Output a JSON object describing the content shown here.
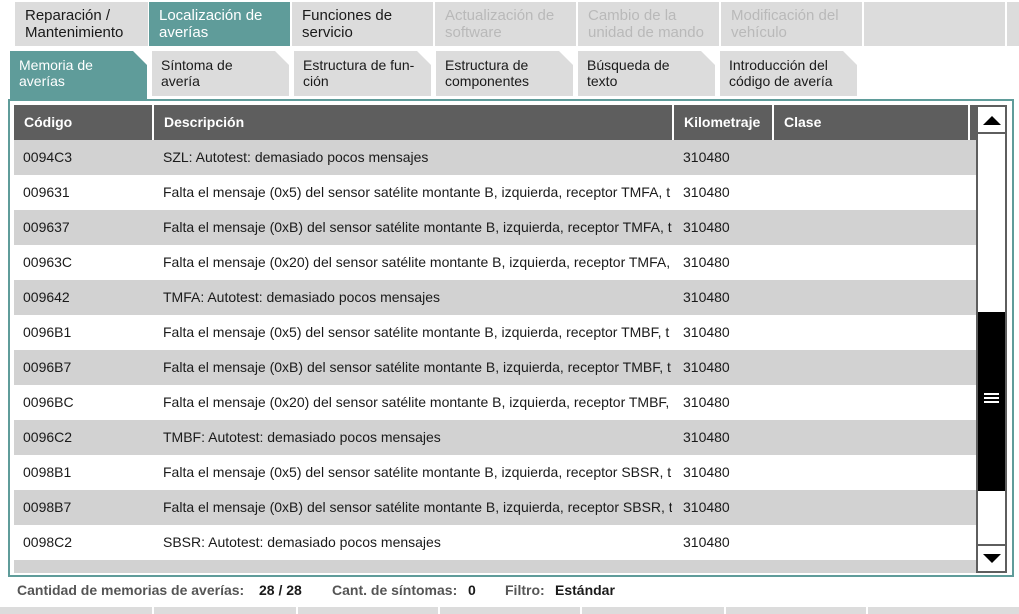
{
  "top_tabs": [
    {
      "label_1": "Reparación /",
      "label_2": "Mantenimiento",
      "state": "normal"
    },
    {
      "label_1": "Localización de",
      "label_2": "averías",
      "state": "active"
    },
    {
      "label_1": "Funciones de",
      "label_2": "servicio",
      "state": "normal"
    },
    {
      "label_1": "Actualización de",
      "label_2": "software",
      "state": "disabled"
    },
    {
      "label_1": "Cambio de la",
      "label_2": "unidad de mando",
      "state": "disabled"
    },
    {
      "label_1": "Modificación del",
      "label_2": "vehículo",
      "state": "disabled"
    }
  ],
  "sub_tabs": [
    {
      "label_1": "Memoria de",
      "label_2": "averías",
      "state": "active"
    },
    {
      "label_1": "Síntoma de",
      "label_2": "avería",
      "state": "normal"
    },
    {
      "label_1": "Estructura de fun-",
      "label_2": "ción",
      "state": "normal"
    },
    {
      "label_1": "Estructura de",
      "label_2": "componentes",
      "state": "normal"
    },
    {
      "label_1": "Búsqueda de",
      "label_2": "texto",
      "state": "normal"
    },
    {
      "label_1": "Introducción del",
      "label_2": "código de avería",
      "state": "normal"
    }
  ],
  "table": {
    "headers": {
      "code": "Código",
      "description": "Descripción",
      "mileage": "Kilometraje",
      "class": "Clase"
    },
    "rows": [
      {
        "code": "0094C3",
        "description": "SZL: Autotest: demasiado pocos mensajes",
        "mileage": "310480",
        "class": ""
      },
      {
        "code": "009631",
        "description": "Falta el mensaje (0x5) del sensor satélite montante B, izquierda, receptor TMFA, t",
        "mileage": "310480",
        "class": ""
      },
      {
        "code": "009637",
        "description": "Falta el mensaje (0xB) del sensor satélite montante B, izquierda, receptor TMFA, t",
        "mileage": "310480",
        "class": ""
      },
      {
        "code": "00963C",
        "description": "Falta el mensaje (0x20) del sensor satélite montante B, izquierda, receptor TMFA,",
        "mileage": "310480",
        "class": ""
      },
      {
        "code": "009642",
        "description": "TMFA: Autotest: demasiado pocos mensajes",
        "mileage": "310480",
        "class": ""
      },
      {
        "code": "0096B1",
        "description": "Falta el mensaje (0x5) del sensor satélite montante B, izquierda, receptor TMBF, t",
        "mileage": "310480",
        "class": ""
      },
      {
        "code": "0096B7",
        "description": "Falta el mensaje (0xB) del sensor satélite montante B, izquierda, receptor TMBF, t",
        "mileage": "310480",
        "class": ""
      },
      {
        "code": "0096BC",
        "description": "Falta el mensaje (0x20) del sensor satélite montante B, izquierda, receptor TMBF,",
        "mileage": "310480",
        "class": ""
      },
      {
        "code": "0096C2",
        "description": "TMBF: Autotest: demasiado pocos mensajes",
        "mileage": "310480",
        "class": ""
      },
      {
        "code": "0098B1",
        "description": "Falta el mensaje (0x5) del sensor satélite montante B, izquierda, receptor SBSR, t",
        "mileage": "310480",
        "class": ""
      },
      {
        "code": "0098B7",
        "description": "Falta el mensaje (0xB) del sensor satélite montante B, izquierda, receptor SBSR, t",
        "mileage": "310480",
        "class": ""
      },
      {
        "code": "0098C2",
        "description": "SBSR: Autotest: demasiado pocos mensajes",
        "mileage": "310480",
        "class": ""
      },
      {
        "code": "",
        "description": "",
        "mileage": "",
        "class": ""
      }
    ]
  },
  "status": {
    "fault_count_label": "Cantidad de memorias de averías:",
    "fault_count_value": "28 / 28",
    "symptom_count_label": "Cant. de síntomas:",
    "symptom_count_value": "0",
    "filter_label": "Filtro:",
    "filter_value": "Estándar"
  },
  "colors": {
    "accent": "#5f9c9a",
    "header_bg": "#5e5e5e",
    "row_alt": "#d2d2d2",
    "tab_bg": "#dcdcdc"
  }
}
